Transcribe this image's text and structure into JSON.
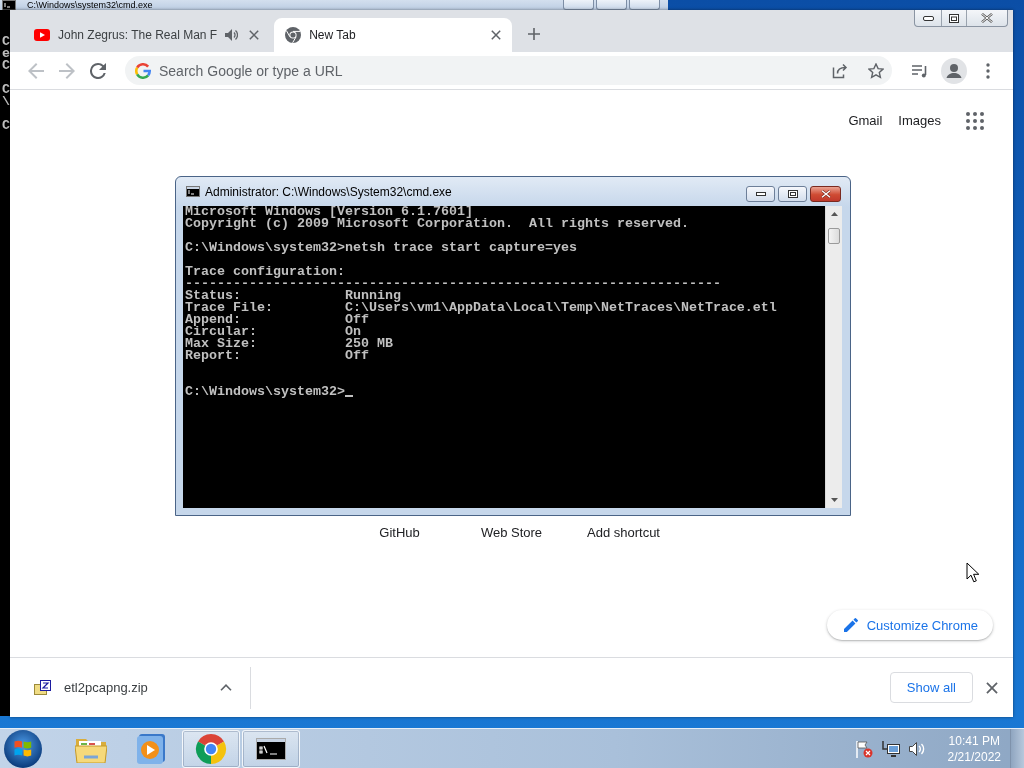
{
  "background_window": {
    "title": "C:\\Windows\\system32\\cmd.exe",
    "console_text": "C\ne\nC\n\nC\n\\\n\nC"
  },
  "browser": {
    "tabs": [
      {
        "title": "John Zegrus: The Real Man F",
        "kind": "video",
        "audio": true,
        "selected": false
      },
      {
        "title": "New Tab",
        "kind": "newtab",
        "audio": false,
        "selected": true
      }
    ],
    "nav_buttons": [
      {
        "kind": "back",
        "disabled": true
      },
      {
        "kind": "forward",
        "disabled": true
      },
      {
        "kind": "reload",
        "disabled": false
      }
    ],
    "omnibox": {
      "placeholder": "Search Google or type a URL"
    },
    "header_links": [
      "Gmail",
      "Images"
    ],
    "shortcuts": [
      "GitHub",
      "Web Store",
      "Add shortcut"
    ],
    "customize_button": "Customize Chrome",
    "downloads": {
      "items": [
        {
          "name": "etl2pcapng.zip"
        }
      ],
      "show_all": "Show all"
    }
  },
  "console_window": {
    "title": "Administrator: C:\\Windows\\System32\\cmd.exe",
    "output": "Microsoft Windows [Version 6.1.7601]\nCopyright (c) 2009 Microsoft Corporation.  All rights reserved.\n\nC:\\Windows\\system32>netsh trace start capture=yes\n\nTrace configuration:\n-------------------------------------------------------------------\nStatus:             Running\nTrace File:         C:\\Users\\vm1\\AppData\\Local\\Temp\\NetTraces\\NetTrace.etl\nAppend:             Off\nCircular:           On\nMax Size:           250 MB\nReport:             Off",
    "prompt": "C:\\Windows\\system32>"
  },
  "taskbar": {
    "apps": [
      {
        "kind": "explorer",
        "running": false
      },
      {
        "kind": "media",
        "running": false
      },
      {
        "kind": "browser",
        "running": true
      },
      {
        "kind": "console",
        "running": true
      }
    ],
    "clock": {
      "time": "10:41 PM",
      "date": "2/21/2022"
    }
  }
}
